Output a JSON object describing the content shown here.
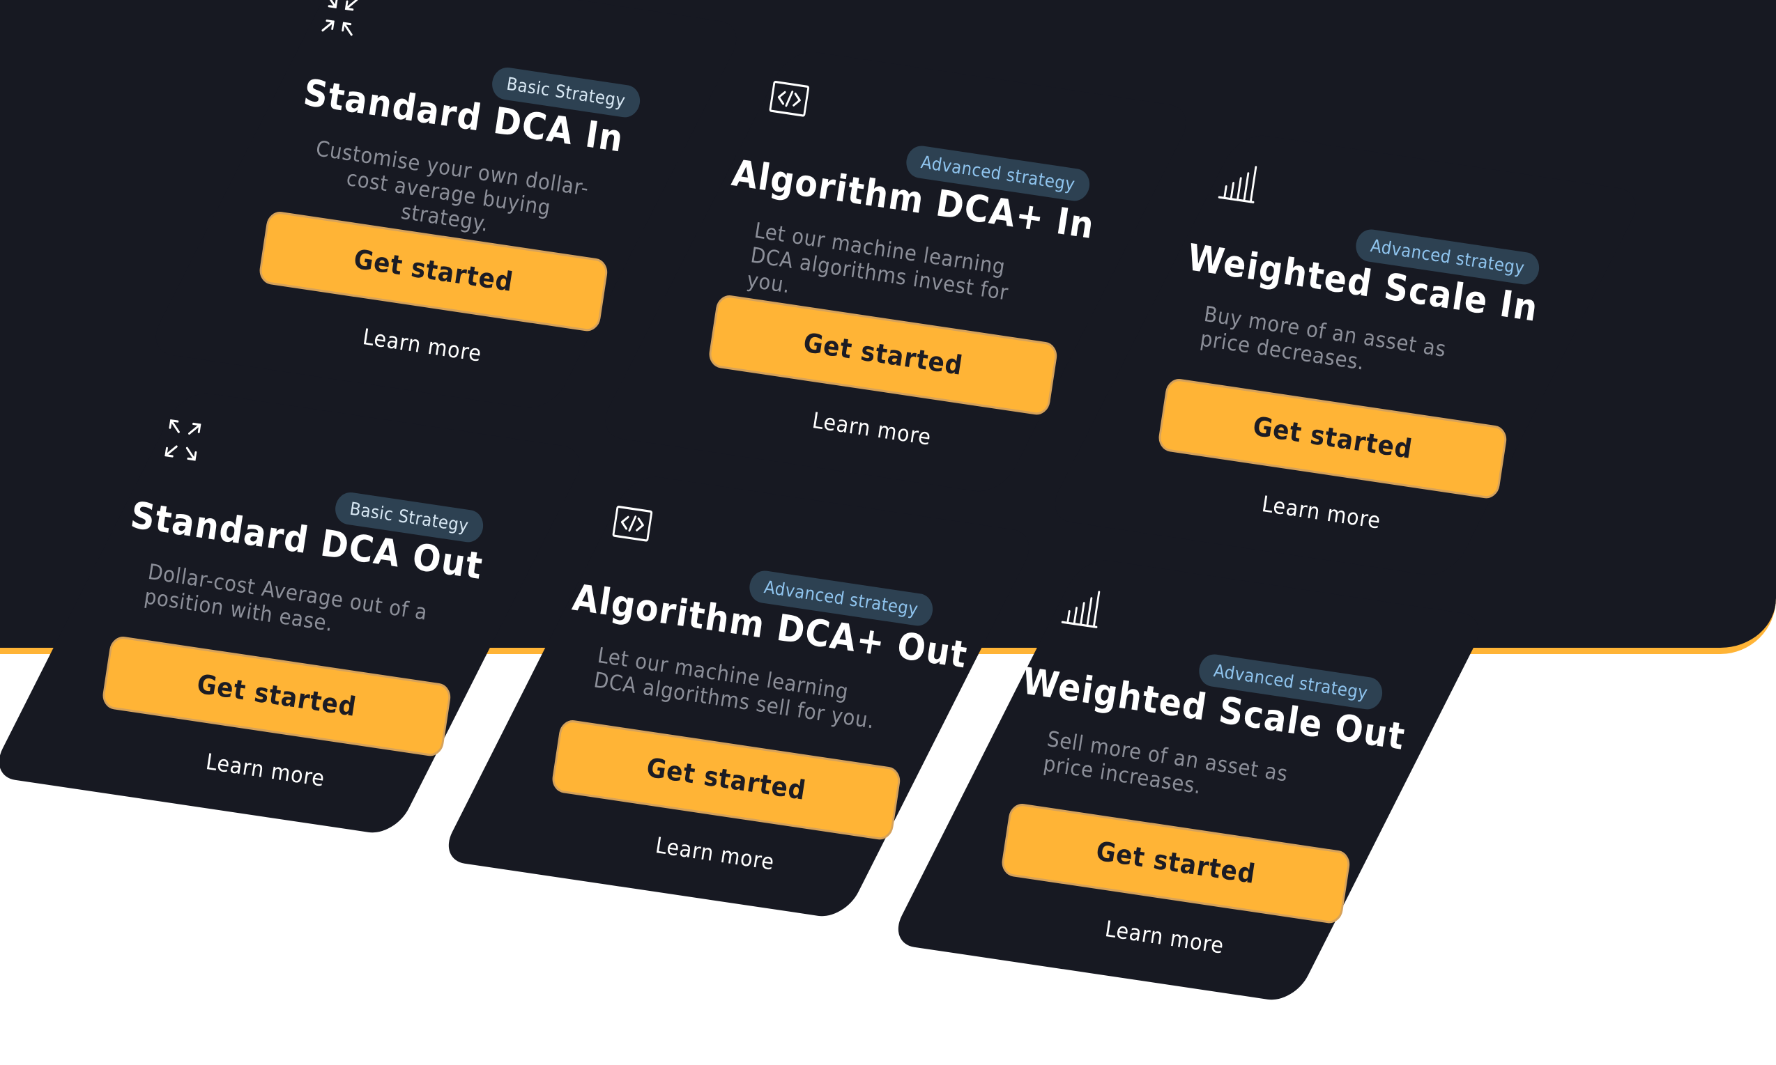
{
  "cards": [
    {
      "icon": "compress-arrows-icon",
      "badge": "Basic Strategy",
      "title": "Standard DCA In",
      "description": "Customise your own dollar-cost average buying strategy.",
      "button": "Get started",
      "link": "Learn more"
    },
    {
      "icon": "code-icon",
      "badge": "Advanced strategy",
      "title": "Algorithm DCA+ In",
      "description": "Let our machine learning DCA algorithms invest for you.",
      "button": "Get started",
      "link": "Learn more"
    },
    {
      "icon": "bar-chart-icon",
      "badge": "Advanced strategy",
      "title": "Weighted Scale In",
      "description": "Buy more of an asset as price decreases.",
      "button": "Get started",
      "link": "Learn more"
    },
    {
      "icon": "expand-arrows-icon",
      "badge": "Basic Strategy",
      "title": "Standard DCA Out",
      "description": "Dollar-cost Average out of a position with ease.",
      "button": "Get started",
      "link": "Learn more"
    },
    {
      "icon": "code-icon",
      "badge": "Advanced strategy",
      "title": "Algorithm DCA+ Out",
      "description": "Let our machine learning DCA algorithms sell for you.",
      "button": "Get started",
      "link": "Learn more"
    },
    {
      "icon": "bar-chart-icon",
      "badge": "Advanced strategy",
      "title": "Weighted Scale Out",
      "description": "Sell more of an asset as price increases.",
      "button": "Get started",
      "link": "Learn more"
    }
  ],
  "colors": {
    "background_dark": "#171922",
    "accent": "#ffb436",
    "badge_bg": "#2d4152",
    "badge_text_advanced": "#8fc4ee",
    "muted_text": "#8c8f99"
  }
}
